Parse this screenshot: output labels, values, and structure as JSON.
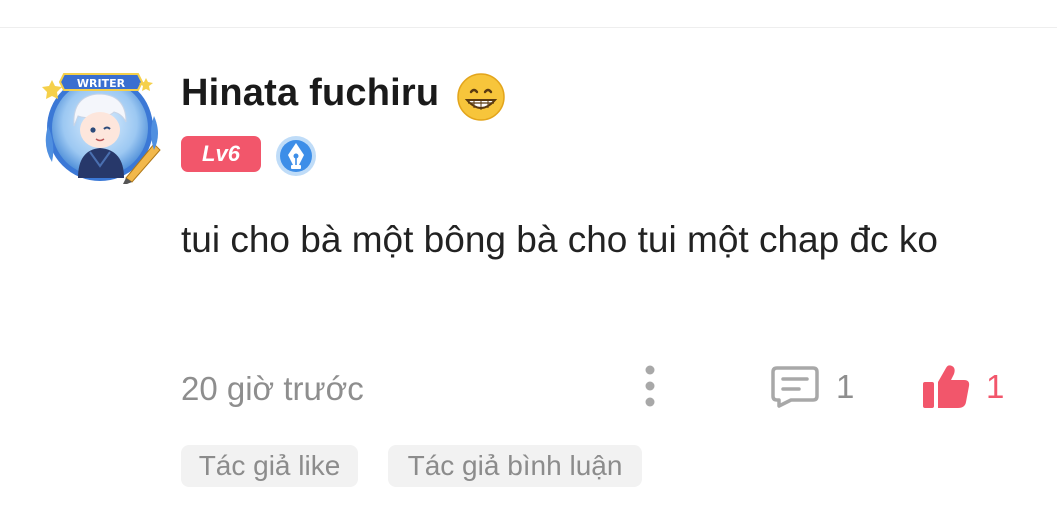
{
  "comment": {
    "username": "Hinata fuchiru",
    "level": "Lv6",
    "avatar_label": "WRITER",
    "text": "tui cho bà một bông bà cho tui một chap đc ko",
    "timestamp": "20 giờ trước",
    "reply_count": "1",
    "like_count": "1",
    "tags": [
      "Tác giả like",
      "Tác giả bình luận"
    ]
  },
  "icons": {
    "emoji": "grinning-face-emoji",
    "writer_badge": "pen-nib-badge-icon",
    "more": "vertical-dots-icon",
    "reply": "comment-bubble-icon",
    "like": "thumbs-up-icon"
  },
  "colors": {
    "accent": "#f2566b",
    "muted_text": "#8e8e8e",
    "badge_blue": "#3d8ee8",
    "tag_background": "#f2f2f2"
  }
}
